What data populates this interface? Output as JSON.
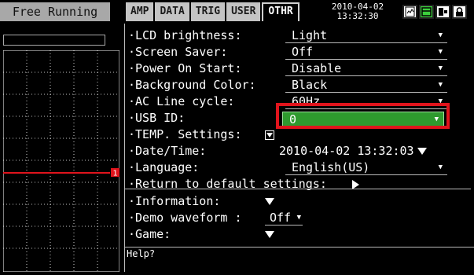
{
  "header": {
    "mode_label": "Free Running",
    "tabs": [
      {
        "label": "AMP",
        "active": false
      },
      {
        "label": "DATA",
        "active": false
      },
      {
        "label": "TRIG",
        "active": false
      },
      {
        "label": "USER",
        "active": false
      },
      {
        "label": "OTHR",
        "active": true
      }
    ],
    "date": "2010-04-02",
    "time": "13:32:30",
    "status_icons": [
      "sd-card-icon",
      "internal-memory-icon",
      "usb-drive-icon",
      "key-lock-icon"
    ]
  },
  "left_panel": {
    "channel_marker": "1"
  },
  "settings": {
    "lcd_brightness": {
      "label": "·LCD brightness:",
      "value": "Light"
    },
    "screen_saver": {
      "label": "·Screen Saver:",
      "value": "Off"
    },
    "power_on_start": {
      "label": "·Power On Start:",
      "value": "Disable"
    },
    "background_color": {
      "label": "·Background Color:",
      "value": "Black"
    },
    "ac_line_cycle": {
      "label": "·AC Line cycle:",
      "value": "60Hz"
    },
    "usb_id": {
      "label": "·USB ID:",
      "value": "0"
    },
    "temp_settings": {
      "label": "·TEMP. Settings:"
    },
    "date_time": {
      "label": "·Date/Time:",
      "value": "2010-04-02 13:32:03"
    },
    "language": {
      "label": "·Language:",
      "value": "English(US)"
    },
    "return_default": {
      "label": "·Return to default settings:"
    },
    "information": {
      "label": "·Information:"
    },
    "demo_waveform": {
      "label": "·Demo waveform :",
      "value": "Off"
    },
    "game": {
      "label": "·Game:"
    }
  },
  "help": {
    "text": "Help?"
  },
  "colors": {
    "selected": "#2e9a2e",
    "highlight_box": "#e0141c",
    "trace": "#e0141c",
    "grid": "#ffffff"
  }
}
